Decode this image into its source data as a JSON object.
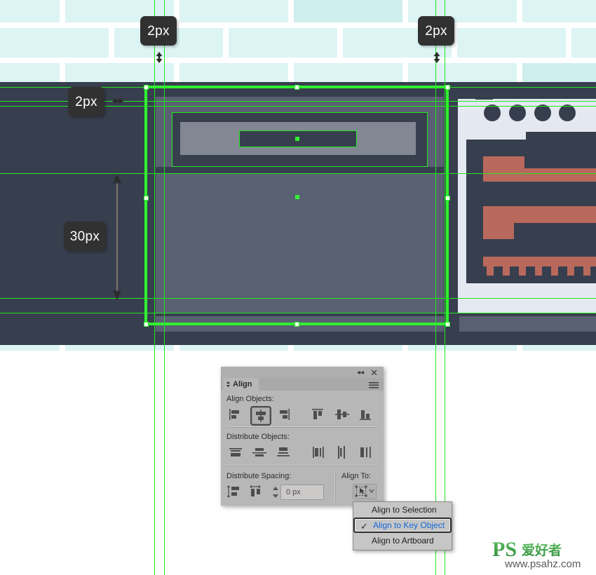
{
  "app": {
    "title": "Align",
    "panel_close_icon": "close-icon",
    "panel_collapse_icon": "collapse-icon",
    "panel_menu_icon": "hamburger-menu-icon",
    "tab_icon": "panel-tab-diamond-icon"
  },
  "panel": {
    "sections": {
      "align_objects_label": "Align Objects:",
      "distribute_objects_label": "Distribute Objects:",
      "distribute_spacing_label": "Distribute Spacing:",
      "align_to_label": "Align To:"
    },
    "align_objects_buttons": [
      {
        "name": "align-left-button",
        "icon": "align-left-icon",
        "active": false
      },
      {
        "name": "align-horizontal-center-button",
        "icon": "align-horizontal-center-icon",
        "active": true
      },
      {
        "name": "align-right-button",
        "icon": "align-right-icon",
        "active": false
      },
      {
        "name": "align-top-button",
        "icon": "align-top-icon",
        "active": false
      },
      {
        "name": "align-vertical-center-button",
        "icon": "align-vertical-center-icon",
        "active": false
      },
      {
        "name": "align-bottom-button",
        "icon": "align-bottom-icon",
        "active": false
      }
    ],
    "distribute_objects_buttons": [
      {
        "name": "distribute-vertical-top-button",
        "icon": "distribute-vertical-top-icon"
      },
      {
        "name": "distribute-vertical-center-button",
        "icon": "distribute-vertical-center-icon"
      },
      {
        "name": "distribute-vertical-bottom-button",
        "icon": "distribute-vertical-bottom-icon"
      },
      {
        "name": "distribute-horizontal-left-button",
        "icon": "distribute-horizontal-left-icon"
      },
      {
        "name": "distribute-horizontal-center-button",
        "icon": "distribute-horizontal-center-icon"
      },
      {
        "name": "distribute-horizontal-right-button",
        "icon": "distribute-horizontal-right-icon"
      }
    ],
    "distribute_spacing_buttons": [
      {
        "name": "distribute-vertical-space-button",
        "icon": "vertical-spacing-icon"
      },
      {
        "name": "distribute-horizontal-space-button",
        "icon": "horizontal-spacing-icon"
      }
    ],
    "spacing_value": "0 px",
    "spacing_placeholder": "0 px",
    "align_to_button_icon": "key-object-icon"
  },
  "dropdown": {
    "items": [
      {
        "label": "Align to Selection",
        "selected": false,
        "checked": false
      },
      {
        "label": "Align to Key Object",
        "selected": true,
        "checked": true
      },
      {
        "label": "Align to Artboard",
        "selected": false,
        "checked": false
      }
    ]
  },
  "measurements": [
    {
      "id": "top-left-gap",
      "label": "2px",
      "orientation": "vertical-gap"
    },
    {
      "id": "top-right-gap",
      "label": "2px",
      "orientation": "vertical-gap"
    },
    {
      "id": "left-edge-gap",
      "label": "2px",
      "orientation": "horizontal-gap"
    },
    {
      "id": "height-measure",
      "label": "30px",
      "orientation": "vertical-span"
    }
  ],
  "watermark": {
    "brand": "PS",
    "brand_cn": "爱好者",
    "url": "www.psahz.com"
  },
  "colors": {
    "guide_green": "#22e822",
    "selection_green": "#2ff22f",
    "mockup_dark": "#373e4e",
    "mockup_gray": "#596072",
    "mockup_light_gray": "#828793",
    "panel_light": "#e4e9f1",
    "accent_salmon": "#b9695c",
    "brick": "#dcf4f4",
    "badge_bg": "#313131",
    "dropdown_highlight": "#1569d6"
  }
}
